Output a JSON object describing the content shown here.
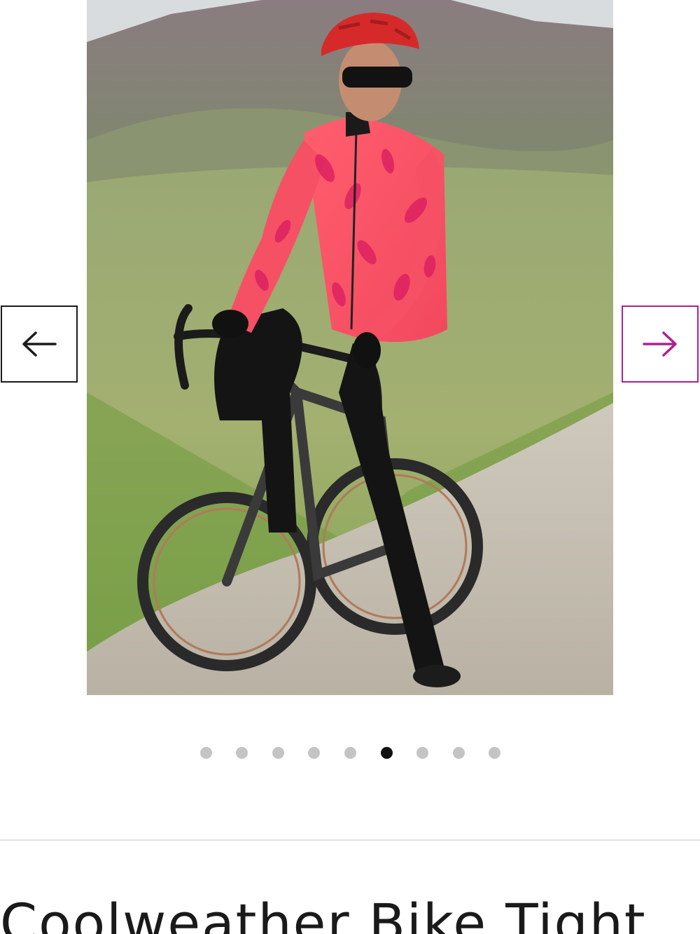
{
  "carousel": {
    "image_description": "",
    "prev_icon": "arrow-left-icon",
    "next_icon": "arrow-right-icon",
    "dot_count": 9,
    "active_index": 5,
    "colors": {
      "prev_border": "#1a1a1a",
      "next_accent": "#b0208f",
      "dot_inactive": "#c4c4c4",
      "dot_active": "#111111"
    }
  },
  "product": {
    "title": "Coolweather Bike Tight"
  }
}
